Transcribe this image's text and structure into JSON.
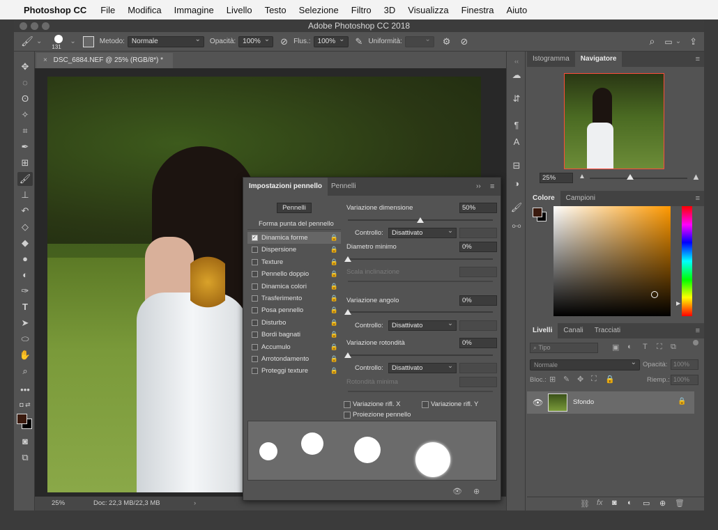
{
  "menubar": {
    "app": "Photoshop CC",
    "items": [
      "File",
      "Modifica",
      "Immagine",
      "Livello",
      "Testo",
      "Selezione",
      "Filtro",
      "3D",
      "Visualizza",
      "Finestra",
      "Aiuto"
    ]
  },
  "window": {
    "title": "Adobe Photoshop CC 2018"
  },
  "options": {
    "brush_size": "131",
    "metodo_label": "Metodo:",
    "metodo_value": "Normale",
    "opacita_label": "Opacità:",
    "opacita_value": "100%",
    "flusso_label": "Flus.:",
    "flusso_value": "100%",
    "uniformita_label": "Uniformità:"
  },
  "document": {
    "tab": "DSC_6884.NEF @ 25% (RGB/8*) *",
    "zoom": "25%",
    "doc_info": "Doc: 22,3 MB/22,3 MB"
  },
  "brush_panel": {
    "tabs": [
      "Impostazioni pennello",
      "Pennelli"
    ],
    "pennelli_button": "Pennelli",
    "header_item": "Forma punta del pennello",
    "items": [
      {
        "label": "Dinamica forme",
        "checked": true
      },
      {
        "label": "Dispersione",
        "checked": false
      },
      {
        "label": "Texture",
        "checked": false
      },
      {
        "label": "Pennello doppio",
        "checked": false
      },
      {
        "label": "Dinamica colori",
        "checked": false
      },
      {
        "label": "Trasferimento",
        "checked": false
      },
      {
        "label": "Posa pennello",
        "checked": false
      },
      {
        "label": "Disturbo",
        "checked": false
      },
      {
        "label": "Bordi bagnati",
        "checked": false
      },
      {
        "label": "Accumulo",
        "checked": false
      },
      {
        "label": "Arrotondamento",
        "checked": false
      },
      {
        "label": "Proteggi texture",
        "checked": false
      }
    ],
    "variazione_dimensione": {
      "label": "Variazione dimensione",
      "value": "50%",
      "level": 0.5
    },
    "controllo_label": "Controllo:",
    "controllo_value": "Disattivato",
    "diametro_minimo": {
      "label": "Diametro minimo",
      "value": "0%",
      "level": 0
    },
    "scala_inclinazione": {
      "label": "Scala inclinazione"
    },
    "variazione_angolo": {
      "label": "Variazione angolo",
      "value": "0%",
      "level": 0
    },
    "variazione_rotondita": {
      "label": "Variazione rotondità",
      "value": "0%",
      "level": 0
    },
    "rotondita_minima": {
      "label": "Rotondità minima"
    },
    "flip_x": "Variazione rifl. X",
    "flip_y": "Variazione rifl. Y",
    "proiezione": "Proiezione pennello"
  },
  "navigator": {
    "tabs": [
      "Istogramma",
      "Navigatore"
    ],
    "zoom": "25%"
  },
  "color": {
    "tabs": [
      "Colore",
      "Campioni"
    ],
    "foreground": "#3a1a0e",
    "background": "#000000",
    "hue": "#ff9900"
  },
  "layers": {
    "tabs": [
      "Livelli",
      "Canali",
      "Tracciati"
    ],
    "filter_placeholder": "Tipo",
    "blend_mode": "Normale",
    "opacity_label": "Opacità:",
    "opacity_value": "100%",
    "lock_label": "Bloc.:",
    "fill_label": "Riemp.:",
    "fill_value": "100%",
    "layer_name": "Sfondo"
  }
}
